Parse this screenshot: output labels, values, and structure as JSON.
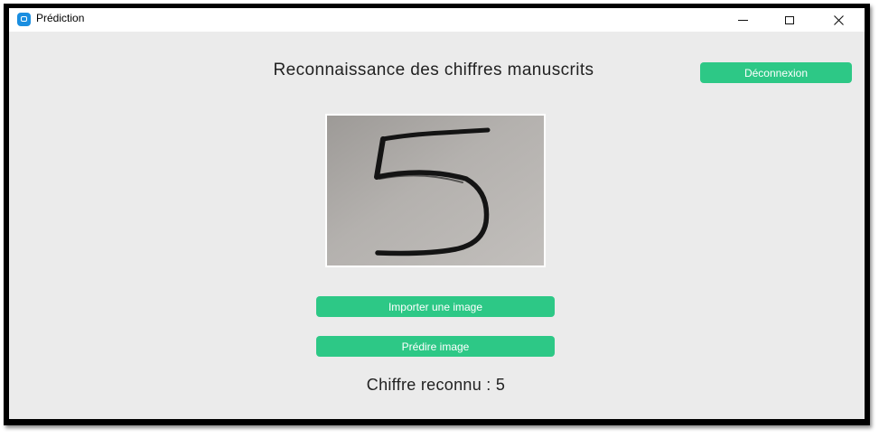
{
  "window": {
    "title": "Prédiction",
    "icon": "app-icon",
    "controls": [
      "minimize-icon",
      "maximize-icon",
      "close-icon"
    ]
  },
  "header": {
    "title": "Reconnaissance des chiffres manuscrits",
    "logout_label": "Déconnexion"
  },
  "image_preview": {
    "content": "handwritten digit 5 photo"
  },
  "actions": {
    "import_label": "Importer une image",
    "predict_label": "Prédire image"
  },
  "result": {
    "text": "Chiffre reconnu : 5"
  },
  "colors": {
    "accent": "#2dc886",
    "window_bg": "#ebebeb",
    "titlebar_bg": "#ffffff",
    "app_icon": "#1a8ee0"
  }
}
